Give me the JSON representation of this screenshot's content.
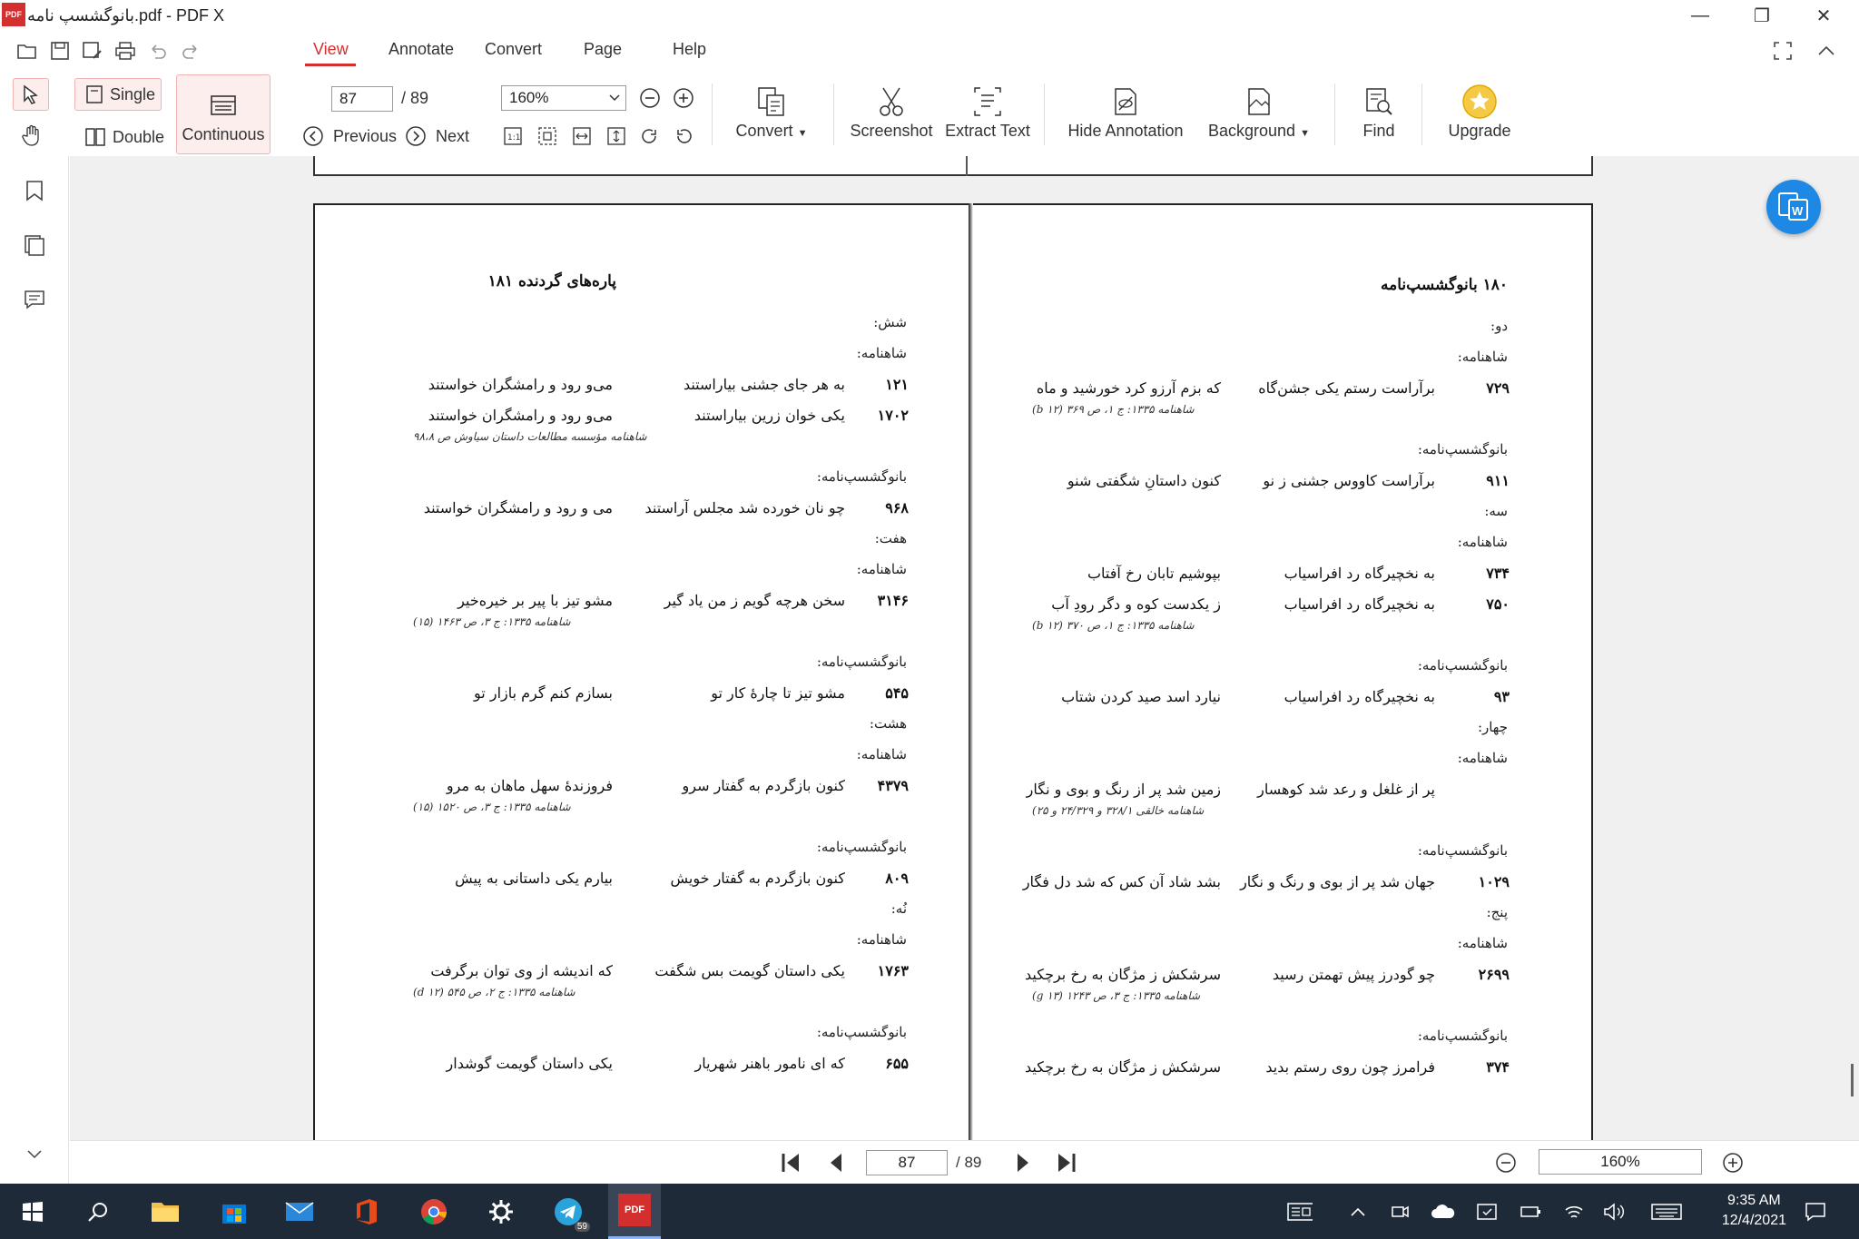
{
  "window": {
    "app_logo_text": "PDF",
    "title": "بانوگشسپ نامه.pdf - PDF X",
    "minimize_glyph": "—",
    "restore_glyph": "❐",
    "close_glyph": "✕"
  },
  "menu": {
    "items": [
      "View",
      "Annotate",
      "Convert",
      "Page",
      "Help"
    ],
    "active": "View"
  },
  "toolbar": {
    "single_label": "Single",
    "double_label": "Double",
    "continuous_label": "Continuous",
    "page_input": "87",
    "page_total": "/ 89",
    "previous_label": "Previous",
    "next_label": "Next",
    "zoom_value": "160%",
    "convert_label": "Convert",
    "screenshot_label": "Screenshot",
    "extract_text_label": "Extract Text",
    "hide_annotation_label": "Hide Annotation",
    "background_label": "Background",
    "find_label": "Find",
    "upgrade_label": "Upgrade"
  },
  "right_page": {
    "header": "۱۸۰  بانوگشسپ‌نامه",
    "blocks": [
      {
        "label": "دو:"
      },
      {
        "label": "شاهنامه:"
      },
      {
        "verse": [
          "۷۲۹",
          "برآراست رستم یکی جشن‌گاه",
          "که بزم آرزو کرد خورشید و ماه"
        ]
      },
      {
        "source": "شاهنامه ۱۳۳۵: ج ۱، ص ۳۶۹ (۱۲ b)"
      },
      {
        "label": "بانوگشسپ‌نامه:"
      },
      {
        "verse": [
          "۹۱۱",
          "برآراست کاووس جشنی ز نو",
          "کنون داستانِ شگفتی شنو"
        ]
      },
      {
        "label": "سه:"
      },
      {
        "label": "شاهنامه:"
      },
      {
        "verse": [
          "۷۳۴",
          "به نخچیرگاه رد افراسیاب",
          "بپوشیم تابان رخ آفتاب"
        ]
      },
      {
        "verse": [
          "۷۵۰",
          "به نخچیرگاه رد افراسیاب",
          "ز یکدست کوه و دگر رودِ آب"
        ]
      },
      {
        "source": "شاهنامه ۱۳۳۵: ج ۱، ص ۳۷۰ (۱۲ b)"
      },
      {
        "label": "بانوگشسپ‌نامه:"
      },
      {
        "verse": [
          "۹۳",
          "به نخچیرگاه رد افراسیاب",
          "نیارد اسد صید کردن شتاب"
        ]
      },
      {
        "label": "چهار:"
      },
      {
        "label": "شاهنامه:"
      },
      {
        "verse": [
          "",
          "پر از غلغل و رعد شد کوهسار",
          "زمین شد پر از رنگ و بوی و نگار"
        ]
      },
      {
        "source": "شاهنامه خالقی ۳۲۸/۱ و ۲۴/۳۲۹ و ۲۵)"
      },
      {
        "label": "بانوگشسپ‌نامه:"
      },
      {
        "verse": [
          "۱۰۲۹",
          "جهان شد پر از بوی و رنگ و نگار",
          "بشد شاد آن کس که شد دل فگار"
        ]
      },
      {
        "label": "پنج:"
      },
      {
        "label": "شاهنامه:"
      },
      {
        "verse": [
          "۲۶۹۹",
          "چو گودرز پیش تهمتن رسید",
          "سرشکش ز مژگان به رخ برچکید"
        ]
      },
      {
        "source": "شاهنامه ۱۳۳۵: ج ۳، ص ۱۲۴۳ (۱۳ g)"
      },
      {
        "label": "بانوگشسپ‌نامه:"
      },
      {
        "verse": [
          "۳۷۴",
          "فرامرز چون روی رستم بدید",
          "سرشکش ز مژگان به رخ برچکید"
        ]
      }
    ]
  },
  "left_page": {
    "header": "پاره‌های گردنده  ۱۸۱",
    "blocks": [
      {
        "label": "شش:"
      },
      {
        "label": "شاهنامه:"
      },
      {
        "verse": [
          "۱۲۱",
          "به هر جای جشنی بیاراستند",
          "می‌و رود و رامشگران خواستند"
        ]
      },
      {
        "verse": [
          "۱۷۰۲",
          "یکی خوان زرین بیاراستند",
          "می‌و رود و رامشگران خواستند"
        ]
      },
      {
        "source": "شاهنامه مؤسسه مطالعات داستان سیاوش ص ۹۸،۸"
      },
      {
        "label": "بانوگشسپ‌نامه:"
      },
      {
        "verse": [
          "۹۶۸",
          "چو نان خورده شد مجلس آراستند",
          "می و رود و رامشگران خواستند"
        ]
      },
      {
        "label": "هفت:"
      },
      {
        "label": "شاهنامه:"
      },
      {
        "verse": [
          "۳۱۴۶",
          "سخن هرچه گویم ز من یاد گیر",
          "مشو تیز با پیر بر خیره‌خیر"
        ]
      },
      {
        "source": "شاهنامه ۱۳۳۵: ج ۳، ص ۱۴۶۳ (۱۵)"
      },
      {
        "label": "بانوگشسپ‌نامه:"
      },
      {
        "verse": [
          "۵۴۵",
          "مشو تیز تا چارهٔ کار تو",
          "بسازم کنم گرم بازار تو"
        ]
      },
      {
        "label": "هشت:"
      },
      {
        "label": "شاهنامه:"
      },
      {
        "verse": [
          "۴۳۷۹",
          "کنون بازگردم به گفتار سرو",
          "فروزندهٔ سهل ماهان به مرو"
        ]
      },
      {
        "source": "شاهنامه ۱۳۳۵: ج ۳، ص ۱۵۲۰ (۱۵)"
      },
      {
        "label": "بانوگشسپ‌نامه:"
      },
      {
        "verse": [
          "۸۰۹",
          "کنون بازگردم به گفتار خویش",
          "بیارم یکی داستانی به پیش"
        ]
      },
      {
        "label": "نُه:"
      },
      {
        "label": "شاهنامه:"
      },
      {
        "verse": [
          "۱۷۶۳",
          "یکی داستان گویمت بس شگفت",
          "که اندیشه از وی توان برگرفت"
        ]
      },
      {
        "source": "شاهنامه ۱۳۳۵: ج ۲، ص ۵۴۵ (۱۲ d)"
      },
      {
        "label": "بانوگشسپ‌نامه:"
      },
      {
        "verse": [
          "۶۵۵",
          "که ای نامور باهنر شهریار",
          "یکی داستان گویمت گوشدار"
        ]
      }
    ]
  },
  "bottom_nav": {
    "page_input": "87",
    "page_total": "/  89",
    "zoom_value": "160%"
  },
  "taskbar": {
    "time": "9:35 AM",
    "date": "12/4/2021",
    "telegram_badge": "59",
    "pdf_app_label": "PDF"
  },
  "colors": {
    "accent": "#d32f2f",
    "taskbar": "#1f2a38",
    "doc_background": "#f0f0f0",
    "convert_word_badge": "#1e88e5"
  }
}
